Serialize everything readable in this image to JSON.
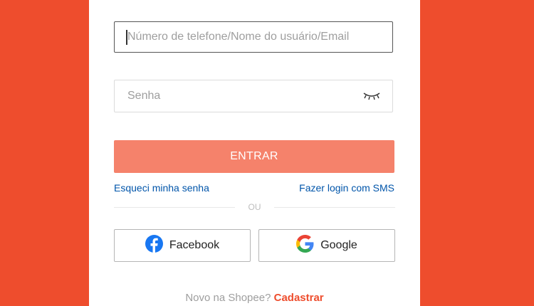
{
  "login": {
    "username_placeholder": "Número de telefone/Nome do usuário/Email",
    "password_placeholder": "Senha",
    "submit_label": "ENTRAR",
    "forgot_password_label": "Esqueci minha senha",
    "sms_login_label": "Fazer login com SMS",
    "divider_label": "OU",
    "facebook_label": "Facebook",
    "google_label": "Google",
    "signup_prompt": "Novo na Shopee?",
    "signup_label": "Cadastrar"
  },
  "icons": {
    "password_toggle": "eye-closed-icon",
    "facebook": "facebook-icon",
    "google": "google-icon"
  },
  "colors": {
    "background": "#ee4d2d",
    "submit_button": "#f5826b",
    "link": "#0055aa",
    "signup_link": "#ee4d2d"
  }
}
